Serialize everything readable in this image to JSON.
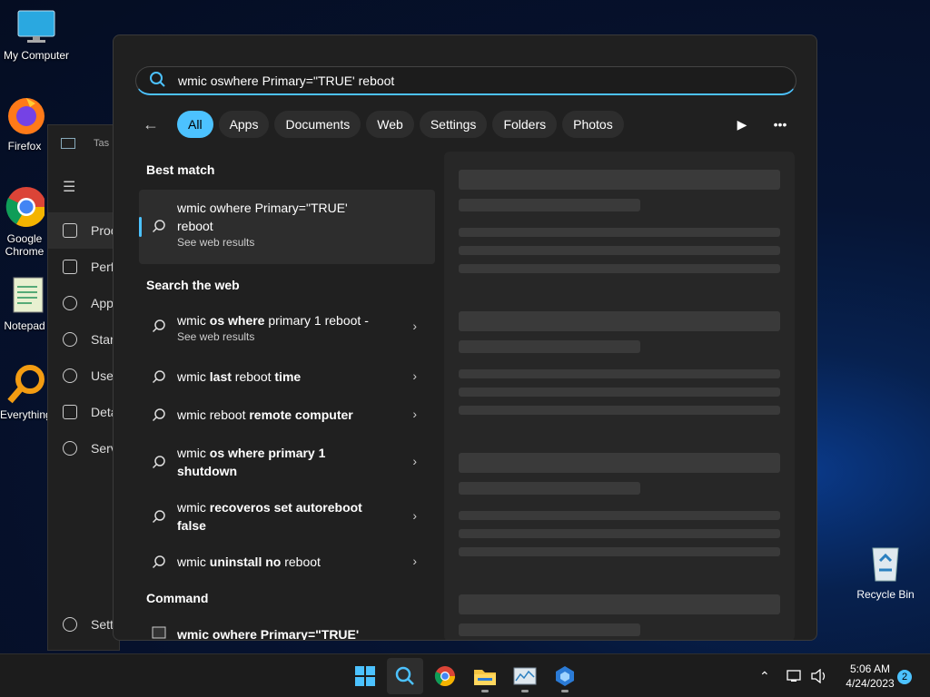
{
  "desktop": {
    "icons": [
      {
        "label": "My Computer"
      },
      {
        "label": "Firefox"
      },
      {
        "label": "Google Chrome"
      },
      {
        "label": "Notepad"
      },
      {
        "label": "Everything"
      }
    ],
    "recycle_bin": "Recycle Bin"
  },
  "task_manager": {
    "title": "Tas",
    "items": [
      "Proc",
      "Perf",
      "App",
      "Star",
      "Use",
      "Deta",
      "Serv"
    ],
    "settings": "Sett"
  },
  "search": {
    "query": "wmic oswhere Primary=\"TRUE' reboot",
    "filters": [
      "All",
      "Apps",
      "Documents",
      "Web",
      "Settings",
      "Folders",
      "Photos"
    ],
    "active_filter": "All",
    "best_match_heading": "Best match",
    "best_match": {
      "line1": "wmic owhere Primary=\"TRUE'",
      "line2": "reboot",
      "sub": "See web results"
    },
    "web_heading": "Search the web",
    "web_results": [
      {
        "pre": "wmic ",
        "bold": "os where",
        "post": " primary 1 reboot -",
        "line2": "",
        "sub": "See web results"
      },
      {
        "pre": "wmic ",
        "bold": "last",
        "post": " reboot ",
        "bold2": "time",
        "line2": "",
        "sub": ""
      },
      {
        "pre": "wmic reboot ",
        "bold": "remote computer",
        "post": "",
        "line2": "",
        "sub": ""
      },
      {
        "pre": "wmic ",
        "bold": "os where primary 1",
        "post": "",
        "line2": "shutdown",
        "sub": ""
      },
      {
        "pre": "wmic ",
        "bold": "recoveros set autoreboot",
        "post": "",
        "line2": "false",
        "sub": ""
      },
      {
        "pre": "wmic ",
        "bold": "uninstall no",
        "post": " reboot",
        "line2": "",
        "sub": ""
      }
    ],
    "command_heading": "Command",
    "command_result": "wmic owhere Primary=\"TRUE'"
  },
  "taskbar": {
    "time": "5:06 AM",
    "date": "4/24/2023",
    "notifications": "2"
  },
  "colors": {
    "accent": "#4cc2ff",
    "panel": "#202020"
  }
}
